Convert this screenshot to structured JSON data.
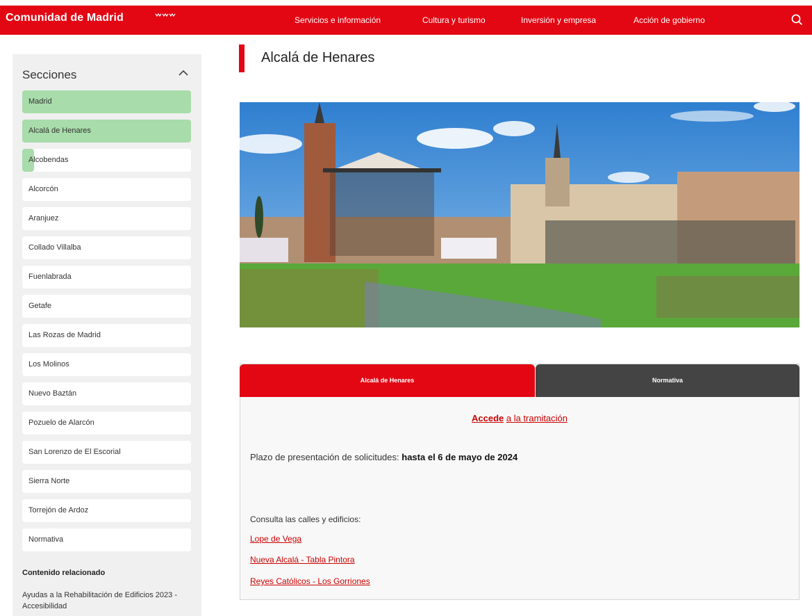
{
  "header": {
    "brand": "Comunidad de Madrid",
    "nav": [
      "Servicios e información",
      "Cultura y turismo",
      "Inversión y empresa",
      "Acción de gobierno"
    ]
  },
  "sidebar": {
    "title": "Secciones",
    "items": [
      {
        "label": "Madrid",
        "state": "active"
      },
      {
        "label": "Alcalá de Henares",
        "state": "active"
      },
      {
        "label": "Alcobendas",
        "state": "partial"
      },
      {
        "label": "Alcorcón",
        "state": ""
      },
      {
        "label": "Aranjuez",
        "state": ""
      },
      {
        "label": "Collado Villalba",
        "state": ""
      },
      {
        "label": "Fuenlabrada",
        "state": ""
      },
      {
        "label": "Getafe",
        "state": ""
      },
      {
        "label": "Las Rozas de Madrid",
        "state": ""
      },
      {
        "label": "Los Molinos",
        "state": ""
      },
      {
        "label": "Nuevo Baztán",
        "state": ""
      },
      {
        "label": "Pozuelo de Alarcón",
        "state": ""
      },
      {
        "label": "San Lorenzo de El Escorial",
        "state": ""
      },
      {
        "label": "Sierra Norte",
        "state": ""
      },
      {
        "label": "Torrejón de Ardoz",
        "state": ""
      },
      {
        "label": "Normativa",
        "state": ""
      }
    ],
    "related_title": "Contenido relacionado",
    "related_link": "Ayudas a la Rehabilitación de Edificios 2023 - Accesibilidad"
  },
  "main": {
    "title": "Alcalá de Henares",
    "tabs": [
      "Alcalá de Henares",
      "Normativa"
    ],
    "accede_bold": "Accede",
    "accede_rest": "a la tramitación",
    "plazo_text": "Plazo de presentación de solicitudes:",
    "plazo_bold": "hasta el 6 de mayo de 2024",
    "consulta": "Consulta las calles y edificios:",
    "links": [
      "Lope de Vega",
      "Nueva Alcalá - Tabla Pintora",
      "Reyes Católicos - Los Gorriones"
    ]
  },
  "colors": {
    "brand_red": "#e30613",
    "active_green": "#a8dcaa",
    "tab_dark": "#444444"
  }
}
